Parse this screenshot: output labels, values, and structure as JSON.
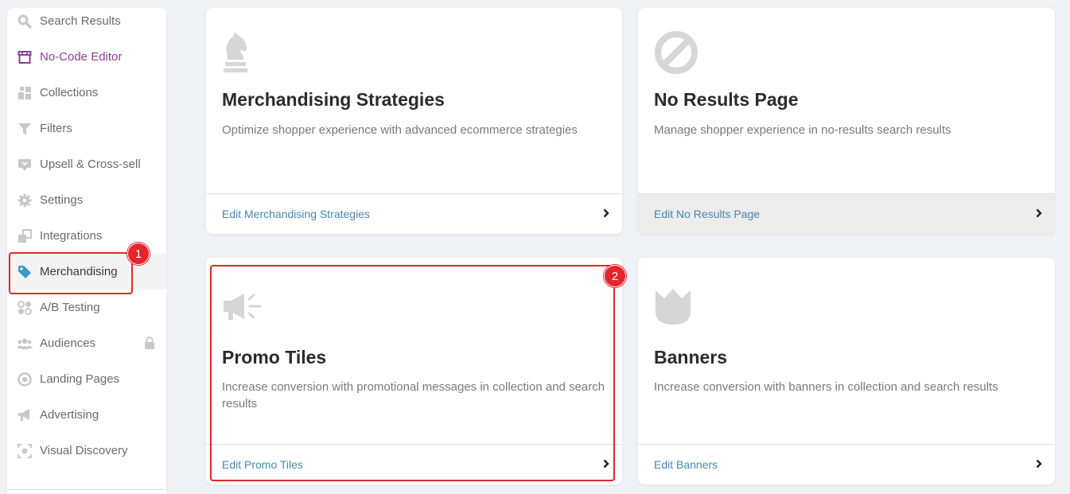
{
  "sidebar": {
    "items": [
      {
        "label": "Search Results",
        "icon": "search-icon"
      },
      {
        "label": "No-Code Editor",
        "icon": "storefront-icon"
      },
      {
        "label": "Collections",
        "icon": "collections-icon"
      },
      {
        "label": "Filters",
        "icon": "filter-icon"
      },
      {
        "label": "Upsell & Cross-sell",
        "icon": "upsell-icon"
      },
      {
        "label": "Settings",
        "icon": "gear-icon"
      },
      {
        "label": "Integrations",
        "icon": "integrations-icon"
      },
      {
        "label": "Merchandising",
        "icon": "tag-icon"
      },
      {
        "label": "A/B Testing",
        "icon": "ab-testing-icon"
      },
      {
        "label": "Audiences",
        "icon": "users-icon"
      },
      {
        "label": "Landing Pages",
        "icon": "landing-page-icon"
      },
      {
        "label": "Advertising",
        "icon": "megaphone-icon"
      },
      {
        "label": "Visual Discovery",
        "icon": "visual-discovery-icon"
      }
    ]
  },
  "cards": {
    "merch": {
      "title": "Merchandising Strategies",
      "description": "Optimize shopper experience with advanced ecommerce strategies",
      "link": "Edit Merchandising Strategies",
      "icon": "chess-knight-icon"
    },
    "noresults": {
      "title": "No Results Page",
      "description": "Manage shopper experience in no-results search results",
      "link": "Edit No Results Page",
      "icon": "ban-icon"
    },
    "promo": {
      "title": "Promo Tiles",
      "description": "Increase conversion with promotional messages in collection and search results",
      "link": "Edit Promo Tiles",
      "icon": "megaphone-icon"
    },
    "banners": {
      "title": "Banners",
      "description": "Increase conversion with banners in collection and search results",
      "link": "Edit Banners",
      "icon": "crown-icon"
    }
  },
  "annotations": {
    "badge1": "1",
    "badge2": "2"
  },
  "colors": {
    "accent_link": "#4a86ad",
    "highlight": "#e3262b",
    "active_tag_icon": "#3a98c9",
    "purple": "#8a3f8f"
  }
}
